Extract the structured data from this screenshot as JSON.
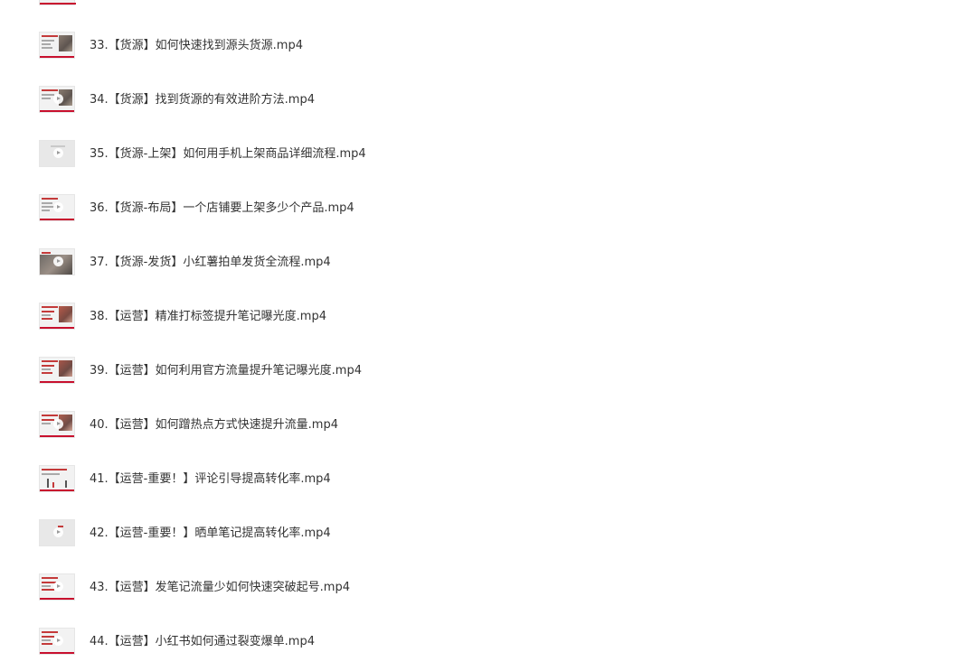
{
  "files": [
    {
      "name": "33.【货源】如何快速找到源头货源.mp4",
      "thumb_icon": "slide-thumbnail"
    },
    {
      "name": "34.【货源】找到货源的有效进阶方法.mp4",
      "thumb_icon": "slide-thumbnail"
    },
    {
      "name": "35.【货源-上架】如何用手机上架商品详细流程.mp4",
      "thumb_icon": "blank-video-thumbnail"
    },
    {
      "name": "36.【货源-布局】一个店铺要上架多少个产品.mp4",
      "thumb_icon": "slide-thumbnail"
    },
    {
      "name": "37.【货源-发货】小红薯拍单发货全流程.mp4",
      "thumb_icon": "photo-thumbnail"
    },
    {
      "name": "38.【运营】精准打标签提升笔记曝光度.mp4",
      "thumb_icon": "slide-thumbnail"
    },
    {
      "name": "39.【运营】如何利用官方流量提升笔记曝光度.mp4",
      "thumb_icon": "slide-thumbnail"
    },
    {
      "name": "40.【运营】如何蹭热点方式快速提升流量.mp4",
      "thumb_icon": "slide-thumbnail"
    },
    {
      "name": "41.【运营-重要！】评论引导提高转化率.mp4",
      "thumb_icon": "chart-thumbnail"
    },
    {
      "name": "42.【运营-重要！】晒单笔记提高转化率.mp4",
      "thumb_icon": "blank-video-thumbnail"
    },
    {
      "name": "43.【运营】发笔记流量少如何快速突破起号.mp4",
      "thumb_icon": "slide-thumbnail"
    },
    {
      "name": "44.【运营】小红书如何通过裂变爆单.mp4",
      "thumb_icon": "slide-thumbnail"
    }
  ],
  "colors": {
    "text": "#333333",
    "accent_red": "#c8102e",
    "background": "#ffffff"
  }
}
